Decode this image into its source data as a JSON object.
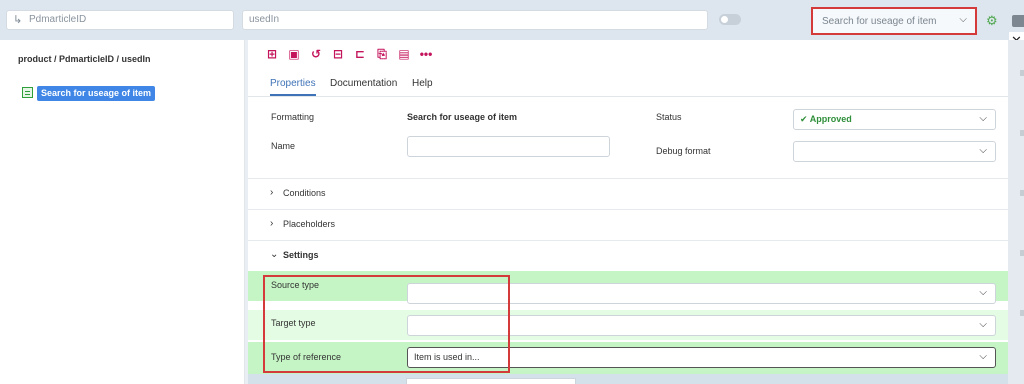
{
  "topbar": {
    "left_input_value": "PdmarticleID",
    "mid_input_value": "usedIn",
    "search_select_value": "Search for useage of item",
    "icons": [
      "return-arrow-icon",
      "gear-icon",
      "document-icon",
      "close-icon"
    ]
  },
  "left_panel": {
    "breadcrumb": "product / PdmarticleID / usedIn",
    "tree_item_label": "Search for useage of item"
  },
  "toolbar": {
    "icons": [
      "tree-structure-icon",
      "save-icon",
      "undo-icon",
      "add-entry-icon",
      "add-child-icon",
      "copy-icon",
      "paste-icon",
      "more-icon"
    ]
  },
  "tabs": [
    {
      "label": "Properties",
      "active": true
    },
    {
      "label": "Documentation",
      "active": false
    },
    {
      "label": "Help",
      "active": false
    }
  ],
  "properties": {
    "formatting_label": "Formatting",
    "formatting_value": "Search for useage of item",
    "name_label": "Name",
    "name_value": "",
    "status_label": "Status",
    "status_value": "Approved",
    "debug_format_label": "Debug format",
    "debug_format_value": ""
  },
  "sections": {
    "conditions": "Conditions",
    "placeholders": "Placeholders",
    "settings": "Settings"
  },
  "settings": {
    "source_type_label": "Source type",
    "source_type_value": "",
    "target_type_label": "Target type",
    "target_type_value": "",
    "type_of_reference_label": "Type of reference",
    "type_of_reference_value": "Item is used in..."
  },
  "colors": {
    "accent": "#3f73b7",
    "toolbar_icon": "#c4145c",
    "highlight_green": "#c5f5c5",
    "annotation_red": "#d43a3a",
    "approved_green": "#2f8f3a"
  }
}
